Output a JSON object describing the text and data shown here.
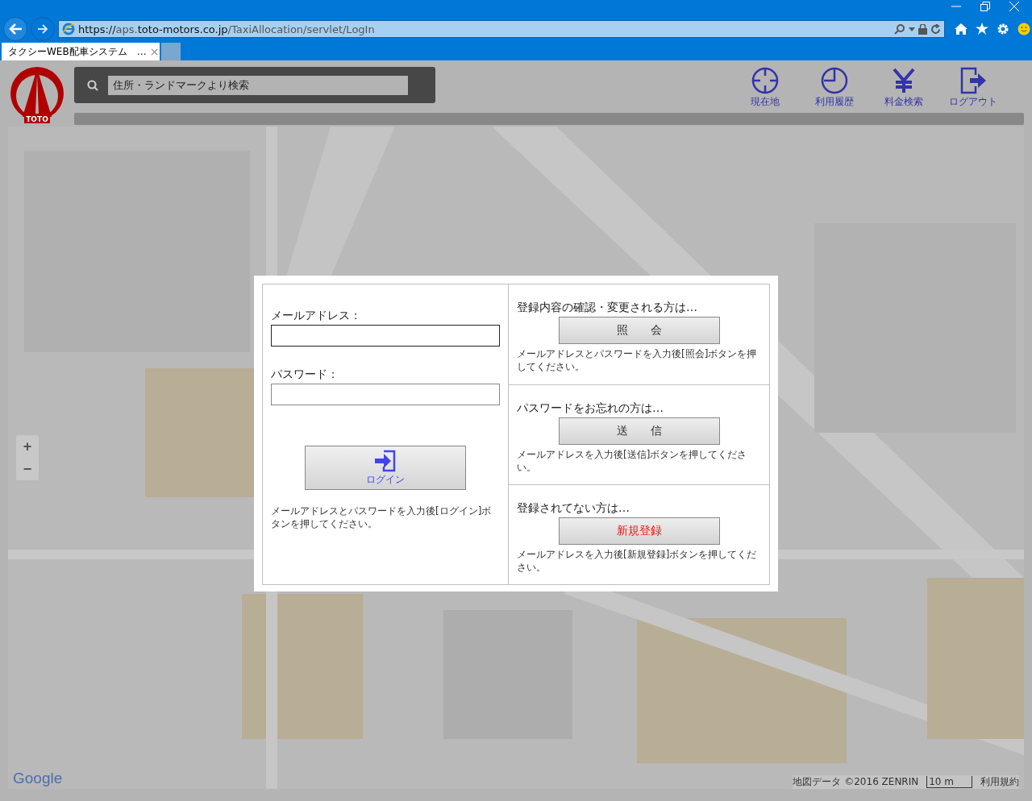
{
  "browser": {
    "url_host_prefix": "https://",
    "url_host": "aps.",
    "url_domain": "toto-motors.co.jp",
    "url_path": "/TaxiAllocation/servlet/LogIn",
    "tabs": [
      {
        "title": "タクシーWEB配車システム　…",
        "selected": true
      },
      {
        "selected": false
      }
    ],
    "close_tab": "×"
  },
  "header": {
    "logo_text": "TOTO",
    "search_placeholder": "住所・ランドマークより検索",
    "nav": [
      {
        "kind": "location",
        "label": "現在地"
      },
      {
        "kind": "history",
        "label": "利用履歴"
      },
      {
        "kind": "fare",
        "label": "料金検索"
      },
      {
        "kind": "logout",
        "label": "ログアウト"
      }
    ]
  },
  "map": {
    "kind": "picture",
    "zoom_in": "+",
    "zoom_out": "−",
    "logo": "Google",
    "attribution": "地図データ ©2016 ZENRIN",
    "scale": "10 m",
    "terms": "利用規約"
  },
  "login": {
    "email_label": "メールアドレス：",
    "password_label": "パスワード：",
    "login_button": "ログイン",
    "login_note": "メールアドレスとパスワードを入力後[ログイン]ボタンを押してください。",
    "sections": [
      {
        "title": "登録内容の確認・変更される方は…",
        "button": "照　　会",
        "accent": false,
        "note": "メールアドレスとパスワードを入力後[照会]ボタンを押してください。"
      },
      {
        "title": "パスワードをお忘れの方は…",
        "button": "送　　信",
        "accent": false,
        "note": "メールアドレスを入力後[送信]ボタンを押してください。"
      },
      {
        "title": "登録されてない方は…",
        "button": "新規登録",
        "accent": true,
        "note": "メールアドレスを入力後[新規登録]ボタンを押してください。"
      }
    ]
  }
}
